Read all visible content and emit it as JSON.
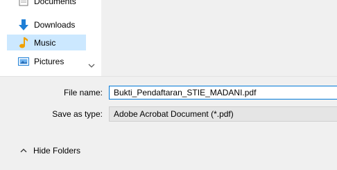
{
  "nav": {
    "items": [
      {
        "label": "Documents",
        "icon": "documents-icon"
      },
      {
        "label": "Downloads",
        "icon": "download-icon"
      },
      {
        "label": "Music",
        "icon": "music-icon"
      },
      {
        "label": "Pictures",
        "icon": "pictures-icon"
      }
    ]
  },
  "form": {
    "file_name_label": "File name:",
    "file_name_value": "Bukti_Pendaftaran_STIE_MADANI.pdf",
    "save_type_label": "Save as type:",
    "save_type_value": "Adobe Acrobat Document (*.pdf)"
  },
  "footer": {
    "hide_folders_label": "Hide Folders"
  },
  "colors": {
    "selected_bg": "#cce8ff",
    "accent_border": "#0078d7",
    "download_blue": "#1e7fd6",
    "music_orange": "#f0a000"
  }
}
